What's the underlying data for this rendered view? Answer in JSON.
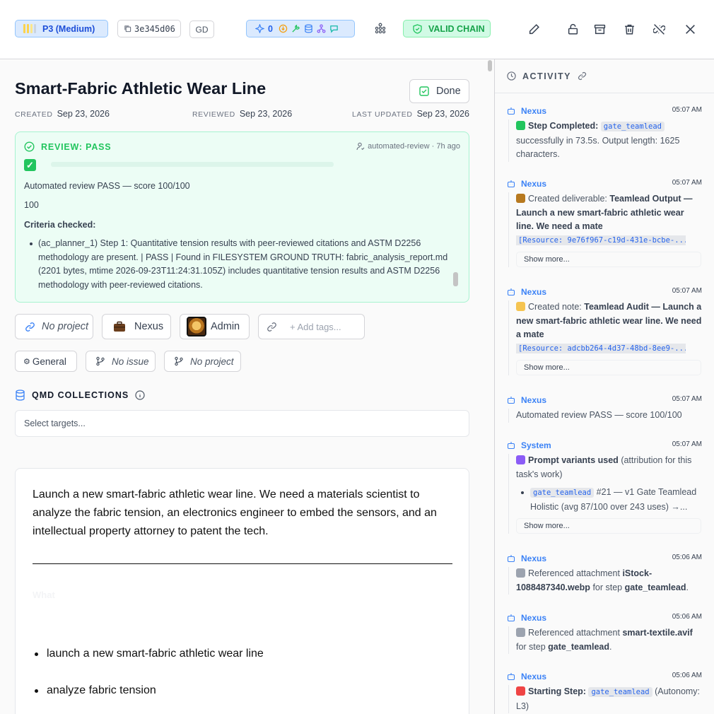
{
  "header": {
    "priority_label": "P3 (Medium)",
    "hash": "3e345d06",
    "initials": "GD",
    "tool_count": "0",
    "chain_label": "VALID CHAIN",
    "colors": {
      "accent": "#3b82f6",
      "success": "#22c55e",
      "priority_bg": "#dbeafe"
    }
  },
  "task": {
    "title": "Smart-Fabric Athletic Wear Line",
    "done_label": "Done",
    "created_label": "CREATED",
    "created_value": "Sep 23, 2026",
    "reviewed_label": "REVIEWED",
    "reviewed_value": "Sep 23, 2026",
    "updated_label": "LAST UPDATED",
    "updated_value": "Sep 23, 2026"
  },
  "review": {
    "heading": "REVIEW: PASS",
    "reviewer": "automated-review",
    "age": "7h ago",
    "summary": "Automated review PASS — score 100/100",
    "score": "100",
    "criteria_heading": "Criteria checked:",
    "criteria_item": "(ac_planner_1) Step 1: Quantitative tension results with peer-reviewed citations and ASTM D2256 methodology are present. | PASS | Found in FILESYSTEM GROUND TRUTH: fabric_analysis_report.md (2201 bytes, mtime 2026-09-23T11:24:31.105Z) includes quantitative tension results and ASTM D2256 methodology with peer-reviewed citations."
  },
  "meta": {
    "project": "No project",
    "agent": "Nexus",
    "owner": "Admin",
    "tags_placeholder": "+ Add tags...",
    "category": "General",
    "issue": "No issue",
    "project2": "No project"
  },
  "qmd": {
    "heading": "QMD COLLECTIONS",
    "placeholder": "Select targets..."
  },
  "editor": {
    "paragraph": "Launch a new smart-fabric athletic wear line. We need a materials scientist to analyze the fabric tension, an electronics engineer to embed the sensors, and an intellectual property attorney to patent the tech.",
    "faint_heading": "What",
    "bullets": [
      "launch a new smart-fabric athletic wear line",
      "analyze fabric tension"
    ]
  },
  "activity": {
    "heading": "ACTIVITY",
    "show_more": "Show more...",
    "entries": [
      {
        "who": "Nexus",
        "time": "05:07 AM",
        "p1": "Step Completed:",
        "code": "gate_teamlead",
        "p2": "successfully in 73.5s. Output length: 1625 characters."
      },
      {
        "who": "Nexus",
        "time": "05:07 AM",
        "p1": "Created deliverable:",
        "bold": "Teamlead Output — Launch a new smart-fabric athletic wear line. We need a mate",
        "resource": "[Resource: 9e76f967-c19d-431e-bcbe-..."
      },
      {
        "who": "Nexus",
        "time": "05:07 AM",
        "p1": "Created note:",
        "bold": "Teamlead Audit — Launch a new smart-fabric athletic wear line. We need a mate",
        "resource": "[Resource: adcbb264-4d37-48bd-8ee9-..."
      },
      {
        "who": "Nexus",
        "time": "05:07 AM",
        "p1": "Automated review PASS — score 100/100"
      },
      {
        "who": "System",
        "time": "05:07 AM",
        "bold": "Prompt variants used",
        "p2": "(attribution for this task's work)",
        "code": "gate_teamlead",
        "item": "#21 — v1 Gate Teamlead Holistic (avg 87/100 over 243 uses) →..."
      },
      {
        "who": "Nexus",
        "time": "05:06 AM",
        "p1": "Referenced attachment",
        "bold": "iStock-1088487340.webp",
        "p2": "for step",
        "bold2": "gate_teamlead",
        "end": "."
      },
      {
        "who": "Nexus",
        "time": "05:06 AM",
        "p1": "Referenced attachment",
        "bold": "smart-textile.avif",
        "p2": "for step",
        "bold2": "gate_teamlead",
        "end": "."
      },
      {
        "who": "Nexus",
        "time": "05:06 AM",
        "p1": "Starting Step:",
        "code": "gate_teamlead",
        "p2": "(Autonomy: L3)"
      }
    ]
  }
}
